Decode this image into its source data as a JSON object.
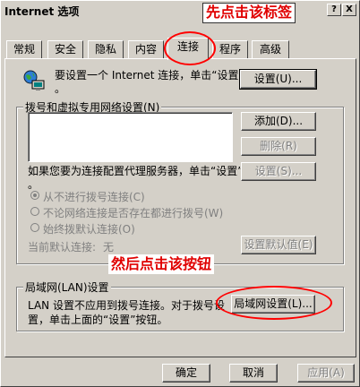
{
  "window": {
    "title": "Internet 选项",
    "help_btn": "?",
    "close_btn": "X"
  },
  "annotations": {
    "top": "先点击该标签",
    "bottom": "然后点击该按钮"
  },
  "tabs": [
    {
      "label": "常规",
      "active": false
    },
    {
      "label": "安全",
      "active": false
    },
    {
      "label": "隐私",
      "active": false
    },
    {
      "label": "内容",
      "active": false
    },
    {
      "label": "连接",
      "active": true
    },
    {
      "label": "程序",
      "active": false
    },
    {
      "label": "高级",
      "active": false
    }
  ],
  "setup": {
    "text": "要设置一个 Internet 连接，单击“设置”",
    "text2": "。",
    "button": "设置(U)..."
  },
  "dialup": {
    "group_label": "拨号和虚拟专用网络设置(N)",
    "add_button": "添加(D)...",
    "delete_button": "删除(R)",
    "settings_button": "设置(S)...",
    "proxy_text": "如果您要为连接配置代理服务器，单击“设置”",
    "proxy_text2": "。",
    "radio1": "从不进行拨号连接(C)",
    "radio2": "不论网络连接是否存在都进行拨号(W)",
    "radio3": "始终拨默认连接(O)",
    "current_default_label": "当前默认连接:",
    "current_default_value": "无",
    "set_default_button": "设置默认值(E)"
  },
  "lan": {
    "group_label": "局域网(LAN)设置",
    "text1": "LAN 设置不应用到拨号连接。对于拨号设",
    "text2": "置，单击上面的“设置”按钮。",
    "button": "局域网设置(L)..."
  },
  "footer": {
    "ok": "确定",
    "cancel": "取消",
    "apply": "应用(A)"
  }
}
